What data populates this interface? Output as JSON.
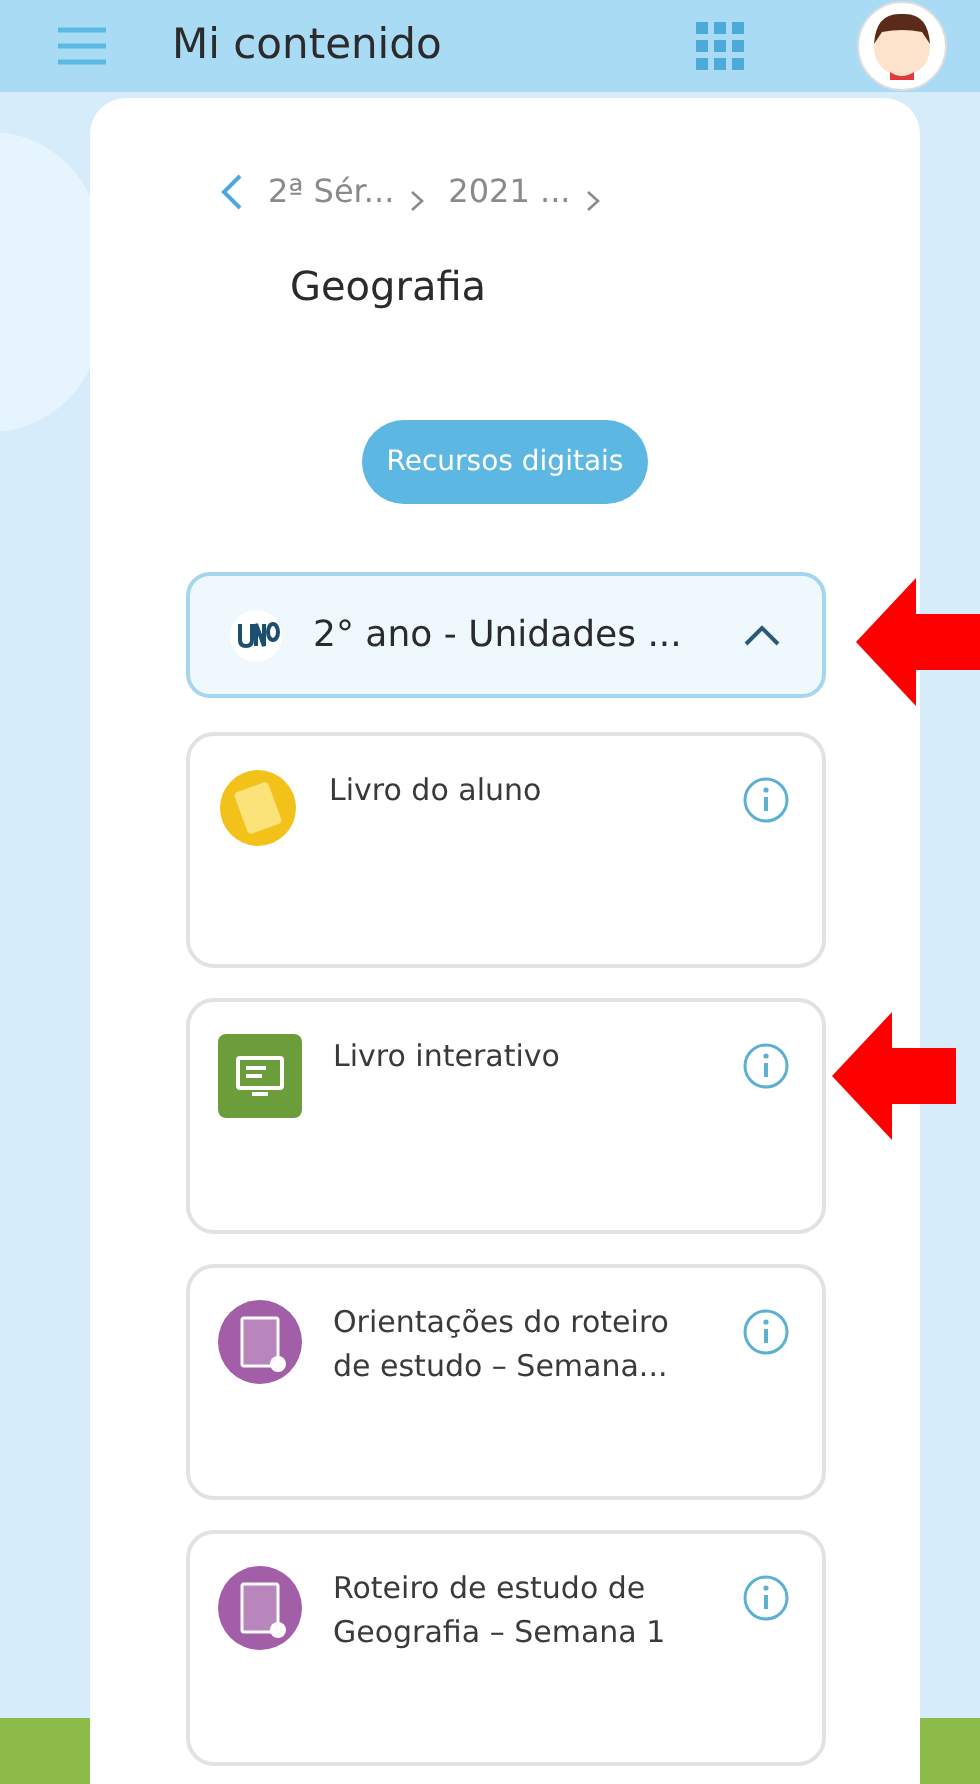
{
  "header": {
    "title": "Mi contenido"
  },
  "breadcrumb": {
    "items": [
      "2ª Sér...",
      "2021 ..."
    ]
  },
  "subject": "Geografia",
  "resources_button": "Recursos digitais",
  "collection": {
    "title": "2° ano - Unidades ...",
    "expanded": true
  },
  "items": [
    {
      "kind": "student-book",
      "title": "Livro do aluno"
    },
    {
      "kind": "interactive-book",
      "title": "Livro interativo"
    },
    {
      "kind": "notebook",
      "title": "Orientações do roteiro de estudo – Semana..."
    },
    {
      "kind": "notebook",
      "title": "Roteiro de estudo de Geografia – Semana 1"
    }
  ]
}
